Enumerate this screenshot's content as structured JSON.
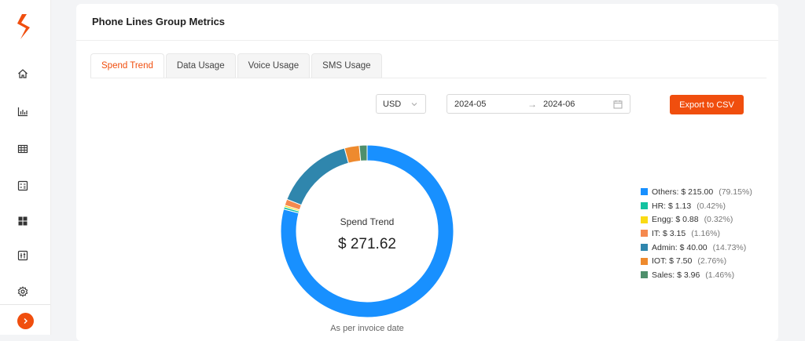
{
  "sidebar": {
    "icons": [
      "home-icon",
      "bar-chart-icon",
      "table-icon",
      "list-calculator-icon",
      "dashboard-grid-icon",
      "sliders-icon",
      "gear-icon"
    ],
    "brand_color": "#f04e0e"
  },
  "card": {
    "title": "Phone Lines Group Metrics"
  },
  "tabs": [
    {
      "label": "Spend Trend",
      "active": true
    },
    {
      "label": "Data Usage",
      "active": false
    },
    {
      "label": "Voice Usage",
      "active": false
    },
    {
      "label": "SMS Usage",
      "active": false
    }
  ],
  "filters": {
    "currency": "USD",
    "date_start": "2024-05",
    "date_end": "2024-06",
    "export_label": "Export to CSV"
  },
  "summary": {
    "center_title": "Spend Trend",
    "center_value": "$ 271.62",
    "caption": "As per invoice date"
  },
  "chart_data": {
    "type": "pie",
    "categories": [
      "Others",
      "HR",
      "Engg",
      "IT",
      "Admin",
      "IOT",
      "Sales"
    ],
    "values": [
      215.0,
      1.13,
      0.88,
      3.15,
      40.0,
      7.5,
      3.96
    ],
    "colors": [
      "#1890ff",
      "#13c2a0",
      "#fadb14",
      "#f5894f",
      "#2f86ad",
      "#ee8a2e",
      "#4e8f6b"
    ],
    "legend": [
      {
        "label": "Others: $ 215.00",
        "pct": "(79.15%)"
      },
      {
        "label": "HR: $ 1.13",
        "pct": "(0.42%)"
      },
      {
        "label": "Engg: $ 0.88",
        "pct": "(0.32%)"
      },
      {
        "label": "IT: $ 3.15",
        "pct": "(1.16%)"
      },
      {
        "label": "Admin: $ 40.00",
        "pct": "(14.73%)"
      },
      {
        "label": "IOT: $ 7.50",
        "pct": "(2.76%)"
      },
      {
        "label": "Sales: $ 3.96",
        "pct": "(1.46%)"
      }
    ],
    "legend_position": "right"
  }
}
